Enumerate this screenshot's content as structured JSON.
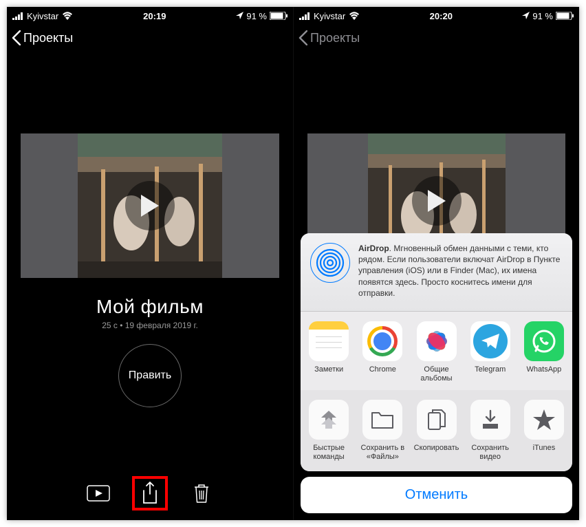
{
  "left": {
    "statusbar": {
      "carrier": "Kyivstar",
      "time": "20:19",
      "battery_text": "91 %"
    },
    "nav_back": "Проекты",
    "project": {
      "title": "Мой фильм",
      "meta": "25 с • 19 февраля 2019 г.",
      "edit_label": "Править"
    }
  },
  "right": {
    "statusbar": {
      "carrier": "Kyivstar",
      "time": "20:20",
      "battery_text": "91 %"
    },
    "nav_back": "Проекты",
    "airdrop": {
      "title": "AirDrop",
      "body": ". Мгновенный обмен данными с теми, кто рядом. Если пользователи включат AirDrop в Пункте управления (iOS) или в Finder (Mac), их имена появятся здесь. Просто коснитесь имени для отправки."
    },
    "apps": [
      {
        "label": "Заметки"
      },
      {
        "label": "Chrome"
      },
      {
        "label": "Общие альбомы"
      },
      {
        "label": "Telegram"
      },
      {
        "label": "WhatsApp"
      }
    ],
    "actions": [
      {
        "label": "Быстрые команды"
      },
      {
        "label": "Сохранить в «Файлы»"
      },
      {
        "label": "Скопировать"
      },
      {
        "label": "Сохранить видео"
      },
      {
        "label": "iTunes"
      }
    ],
    "cancel": "Отменить"
  }
}
